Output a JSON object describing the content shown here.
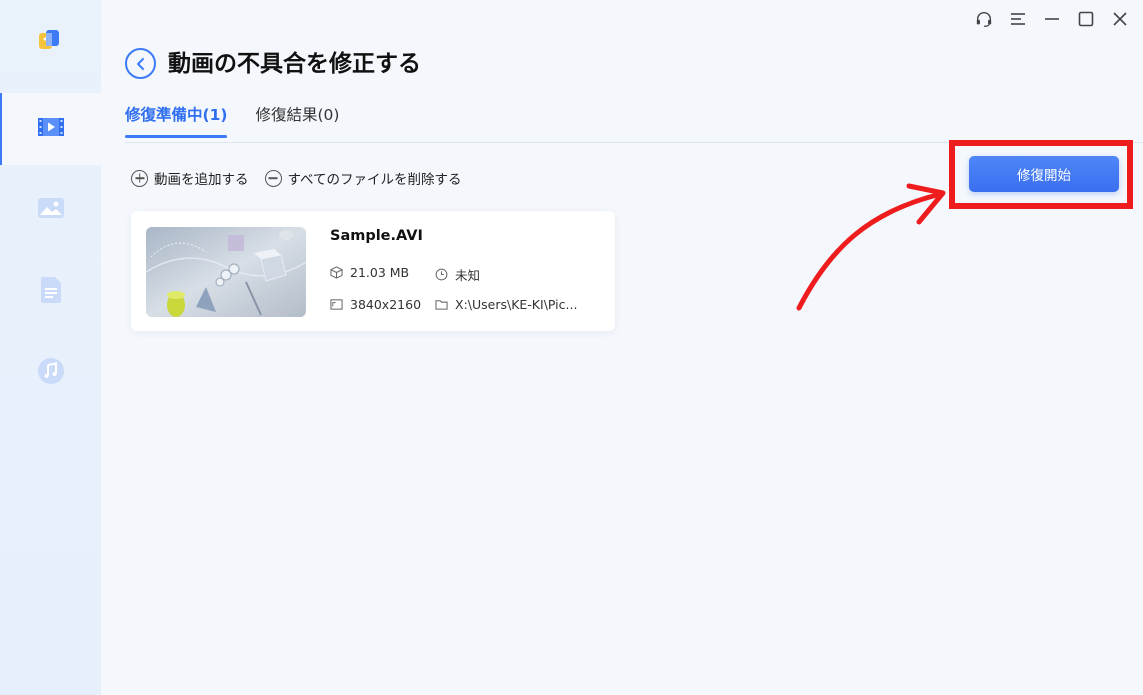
{
  "colors": {
    "accent": "#3d7bf6",
    "highlight": "#ee1c1c",
    "sidebar_bg": "#e7f0fb",
    "main_bg": "#f4f7fc"
  },
  "sidebar": {
    "items": [
      {
        "icon": "video-icon",
        "active": true
      },
      {
        "icon": "image-icon",
        "active": false
      },
      {
        "icon": "document-icon",
        "active": false
      },
      {
        "icon": "music-icon",
        "active": false
      }
    ]
  },
  "window_controls": [
    "support-headset-icon",
    "menu-icon",
    "minimize-icon",
    "maximize-icon",
    "close-icon"
  ],
  "page": {
    "title": "動画の不具合を修正する"
  },
  "tabs": [
    {
      "label": "修復準備中(1)",
      "active": true
    },
    {
      "label": "修復結果(0)",
      "active": false
    }
  ],
  "toolbar": {
    "add_label": "動画を追加する",
    "remove_all_label": "すべてのファイルを削除する"
  },
  "actions": {
    "start_repair_label": "修復開始"
  },
  "file": {
    "name": "Sample.AVI",
    "size": "21.03 MB",
    "duration": "未知",
    "resolution": "3840x2160",
    "path": "X:\\Users\\KE-KI\\Pic..."
  }
}
